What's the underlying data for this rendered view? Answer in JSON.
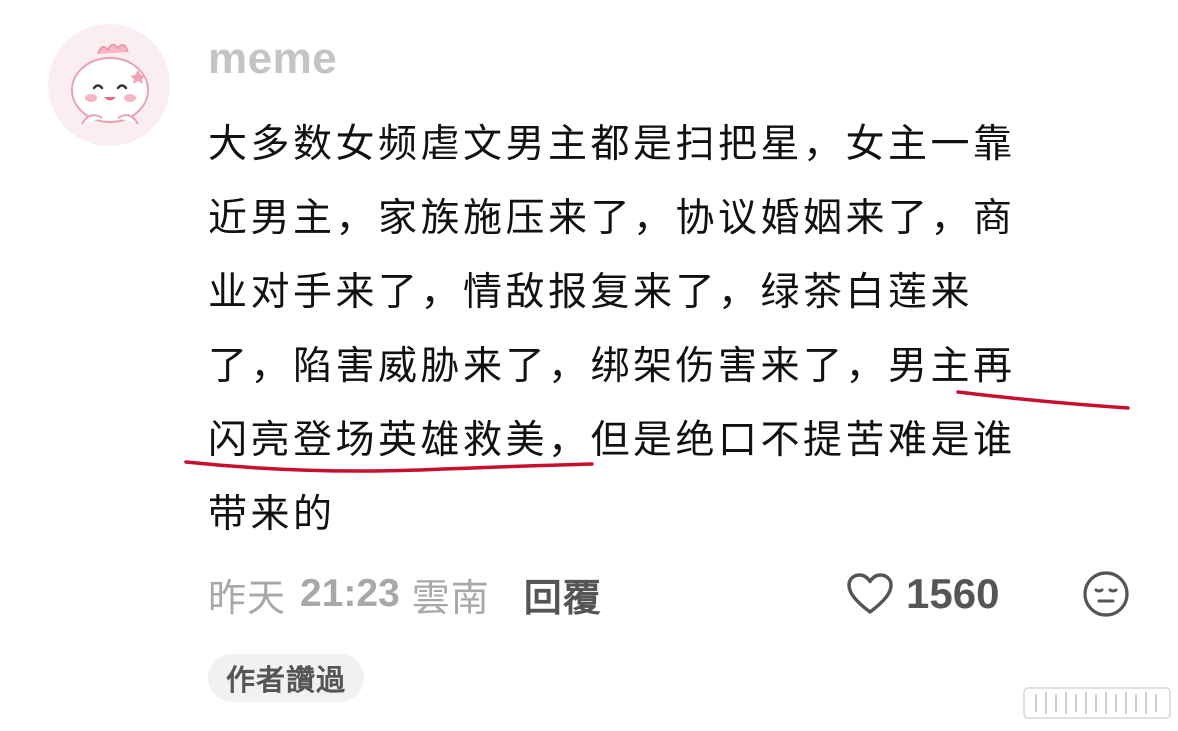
{
  "comment": {
    "username": "meme",
    "lines": [
      "大多数女频虐文男主都是扫把星，女主一靠",
      "近男主，家族施压来了，协议婚姻来了，商",
      "业对手来了，情敌报复来了，绿茶白莲来",
      "了，陷害威胁来了，绑架伤害来了，男主再",
      "闪亮登场英雄救美，但是绝口不提苦难是谁",
      "带来的"
    ],
    "highlighted_phrase": "男主再闪亮登场英雄救美",
    "highlight_color": "#c8102e",
    "meta": {
      "date": "昨天",
      "time": "21:23",
      "location": "雲南",
      "reply_label": "回覆"
    },
    "likes": "1560",
    "author_badge": "作者讚過"
  },
  "colors": {
    "username": "#c4c4c4",
    "text": "#111111",
    "meta": "#a8a8a8",
    "action": "#555555",
    "avatar_bg": "#fbeef0"
  },
  "icons": {
    "avatar": "pink-dino-avatar",
    "like": "heart-outline-icon",
    "reaction": "neutral-face-emoji-icon",
    "watermark": "platform-watermark"
  }
}
